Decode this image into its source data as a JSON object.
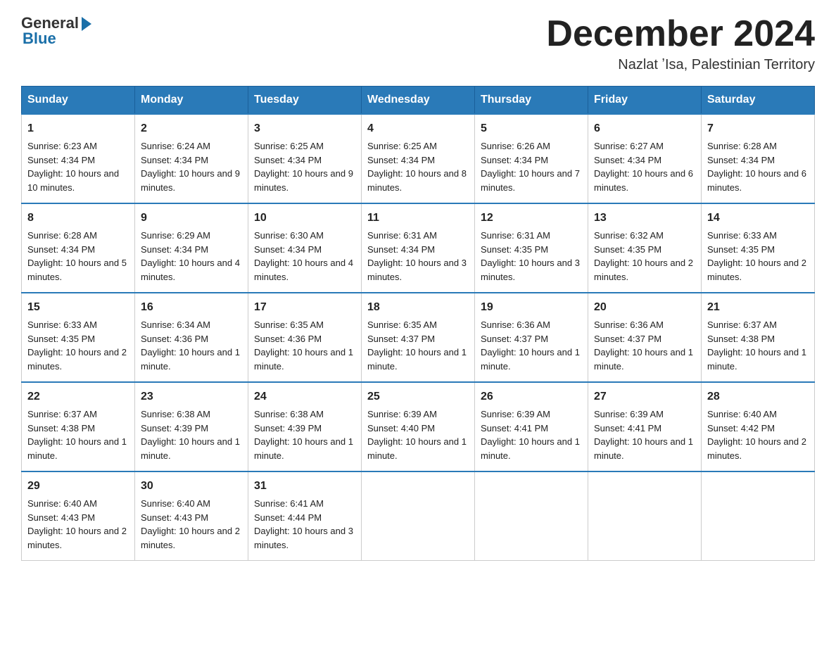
{
  "header": {
    "logo_general": "General",
    "logo_blue": "Blue",
    "month_title": "December 2024",
    "location": "Nazlat ʼIsa, Palestinian Territory"
  },
  "days_of_week": [
    "Sunday",
    "Monday",
    "Tuesday",
    "Wednesday",
    "Thursday",
    "Friday",
    "Saturday"
  ],
  "weeks": [
    [
      {
        "day": "1",
        "sunrise": "6:23 AM",
        "sunset": "4:34 PM",
        "daylight": "10 hours and 10 minutes."
      },
      {
        "day": "2",
        "sunrise": "6:24 AM",
        "sunset": "4:34 PM",
        "daylight": "10 hours and 9 minutes."
      },
      {
        "day": "3",
        "sunrise": "6:25 AM",
        "sunset": "4:34 PM",
        "daylight": "10 hours and 9 minutes."
      },
      {
        "day": "4",
        "sunrise": "6:25 AM",
        "sunset": "4:34 PM",
        "daylight": "10 hours and 8 minutes."
      },
      {
        "day": "5",
        "sunrise": "6:26 AM",
        "sunset": "4:34 PM",
        "daylight": "10 hours and 7 minutes."
      },
      {
        "day": "6",
        "sunrise": "6:27 AM",
        "sunset": "4:34 PM",
        "daylight": "10 hours and 6 minutes."
      },
      {
        "day": "7",
        "sunrise": "6:28 AM",
        "sunset": "4:34 PM",
        "daylight": "10 hours and 6 minutes."
      }
    ],
    [
      {
        "day": "8",
        "sunrise": "6:28 AM",
        "sunset": "4:34 PM",
        "daylight": "10 hours and 5 minutes."
      },
      {
        "day": "9",
        "sunrise": "6:29 AM",
        "sunset": "4:34 PM",
        "daylight": "10 hours and 4 minutes."
      },
      {
        "day": "10",
        "sunrise": "6:30 AM",
        "sunset": "4:34 PM",
        "daylight": "10 hours and 4 minutes."
      },
      {
        "day": "11",
        "sunrise": "6:31 AM",
        "sunset": "4:34 PM",
        "daylight": "10 hours and 3 minutes."
      },
      {
        "day": "12",
        "sunrise": "6:31 AM",
        "sunset": "4:35 PM",
        "daylight": "10 hours and 3 minutes."
      },
      {
        "day": "13",
        "sunrise": "6:32 AM",
        "sunset": "4:35 PM",
        "daylight": "10 hours and 2 minutes."
      },
      {
        "day": "14",
        "sunrise": "6:33 AM",
        "sunset": "4:35 PM",
        "daylight": "10 hours and 2 minutes."
      }
    ],
    [
      {
        "day": "15",
        "sunrise": "6:33 AM",
        "sunset": "4:35 PM",
        "daylight": "10 hours and 2 minutes."
      },
      {
        "day": "16",
        "sunrise": "6:34 AM",
        "sunset": "4:36 PM",
        "daylight": "10 hours and 1 minute."
      },
      {
        "day": "17",
        "sunrise": "6:35 AM",
        "sunset": "4:36 PM",
        "daylight": "10 hours and 1 minute."
      },
      {
        "day": "18",
        "sunrise": "6:35 AM",
        "sunset": "4:37 PM",
        "daylight": "10 hours and 1 minute."
      },
      {
        "day": "19",
        "sunrise": "6:36 AM",
        "sunset": "4:37 PM",
        "daylight": "10 hours and 1 minute."
      },
      {
        "day": "20",
        "sunrise": "6:36 AM",
        "sunset": "4:37 PM",
        "daylight": "10 hours and 1 minute."
      },
      {
        "day": "21",
        "sunrise": "6:37 AM",
        "sunset": "4:38 PM",
        "daylight": "10 hours and 1 minute."
      }
    ],
    [
      {
        "day": "22",
        "sunrise": "6:37 AM",
        "sunset": "4:38 PM",
        "daylight": "10 hours and 1 minute."
      },
      {
        "day": "23",
        "sunrise": "6:38 AM",
        "sunset": "4:39 PM",
        "daylight": "10 hours and 1 minute."
      },
      {
        "day": "24",
        "sunrise": "6:38 AM",
        "sunset": "4:39 PM",
        "daylight": "10 hours and 1 minute."
      },
      {
        "day": "25",
        "sunrise": "6:39 AM",
        "sunset": "4:40 PM",
        "daylight": "10 hours and 1 minute."
      },
      {
        "day": "26",
        "sunrise": "6:39 AM",
        "sunset": "4:41 PM",
        "daylight": "10 hours and 1 minute."
      },
      {
        "day": "27",
        "sunrise": "6:39 AM",
        "sunset": "4:41 PM",
        "daylight": "10 hours and 1 minute."
      },
      {
        "day": "28",
        "sunrise": "6:40 AM",
        "sunset": "4:42 PM",
        "daylight": "10 hours and 2 minutes."
      }
    ],
    [
      {
        "day": "29",
        "sunrise": "6:40 AM",
        "sunset": "4:43 PM",
        "daylight": "10 hours and 2 minutes."
      },
      {
        "day": "30",
        "sunrise": "6:40 AM",
        "sunset": "4:43 PM",
        "daylight": "10 hours and 2 minutes."
      },
      {
        "day": "31",
        "sunrise": "6:41 AM",
        "sunset": "4:44 PM",
        "daylight": "10 hours and 3 minutes."
      },
      null,
      null,
      null,
      null
    ]
  ],
  "labels": {
    "sunrise": "Sunrise:",
    "sunset": "Sunset:",
    "daylight": "Daylight:"
  }
}
